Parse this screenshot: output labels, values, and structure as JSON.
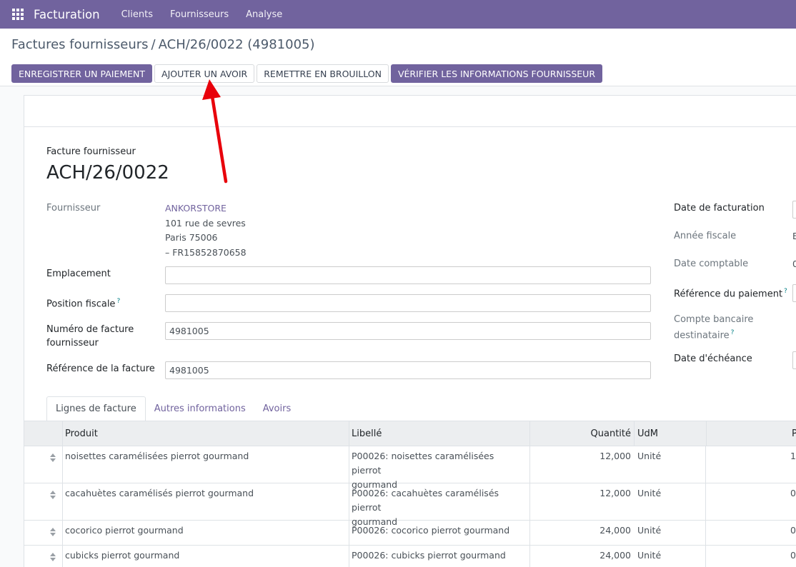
{
  "navbar": {
    "app_icon": "apps-grid-icon",
    "brand": "Facturation",
    "items": [
      "Clients",
      "Fournisseurs",
      "Analyse"
    ]
  },
  "breadcrumb": {
    "parent": "Factures fournisseurs",
    "separator": "/",
    "current": "ACH/26/0022 (4981005)"
  },
  "actions": {
    "register_payment": "ENREGISTRER UN PAIEMENT",
    "add_credit_note": "AJOUTER UN AVOIR",
    "reset_draft": "REMETTRE EN BROUILLON",
    "verify_vendor": "VÉRIFIER LES INFORMATIONS FOURNISSEUR"
  },
  "document": {
    "type": "Facture fournisseur",
    "name": "ACH/26/0022"
  },
  "fields_left": {
    "vendor_label": "Fournisseur",
    "vendor_name": "ANKORSTORE",
    "vendor_address1": "101 rue de sevres",
    "vendor_address2": "Paris 75006",
    "vendor_vat": "– FR15852870658",
    "location_label": "Emplacement",
    "location_value": "",
    "fiscal_position_label": "Position fiscale",
    "fiscal_position_value": "",
    "vendor_invoice_number_label_1": "Numéro de facture",
    "vendor_invoice_number_label_2": "fournisseur",
    "vendor_invoice_number_value": "4981005",
    "invoice_reference_label": "Référence de la facture",
    "invoice_reference_value": "4981005",
    "help_mark": "?"
  },
  "fields_right": {
    "invoice_date_label": "Date de facturation",
    "fiscal_year_label": "Année fiscale",
    "fiscal_year_value": "E",
    "accounting_date_label": "Date comptable",
    "accounting_date_value": "0",
    "payment_reference_label": "Référence du paiement",
    "bank_account_label_1": "Compte bancaire",
    "bank_account_label_2": "destinataire",
    "due_date_label": "Date d'échéance"
  },
  "tabs": [
    "Lignes de facture",
    "Autres informations",
    "Avoirs"
  ],
  "table": {
    "headers": {
      "product": "Produit",
      "label": "Libellé",
      "quantity": "Quantité",
      "uom": "UdM",
      "price": "P"
    },
    "rows": [
      {
        "product": "noisettes caramélisées pierrot gourmand",
        "label1": "P00026: noisettes caramélisées pierrot",
        "label2": "gourmand",
        "quantity": "12,000",
        "uom": "Unité",
        "price": "1,"
      },
      {
        "product": "cacahuètes caramélisés pierrot gourmand",
        "label1": "P00026: cacahuètes caramélisés pierrot",
        "label2": "gourmand",
        "quantity": "12,000",
        "uom": "Unité",
        "price": "0,"
      },
      {
        "product": "cocorico pierrot gourmand",
        "label1": "P00026: cocorico pierrot gourmand",
        "label2": "",
        "quantity": "24,000",
        "uom": "Unité",
        "price": "0,"
      },
      {
        "product": "cubicks pierrot gourmand",
        "label1": "P00026: cubicks pierrot gourmand",
        "label2": "",
        "quantity": "24,000",
        "uom": "Unité",
        "price": "0,"
      }
    ]
  },
  "colors": {
    "brand": "#71639e",
    "annotation_arrow": "#e8000b"
  }
}
